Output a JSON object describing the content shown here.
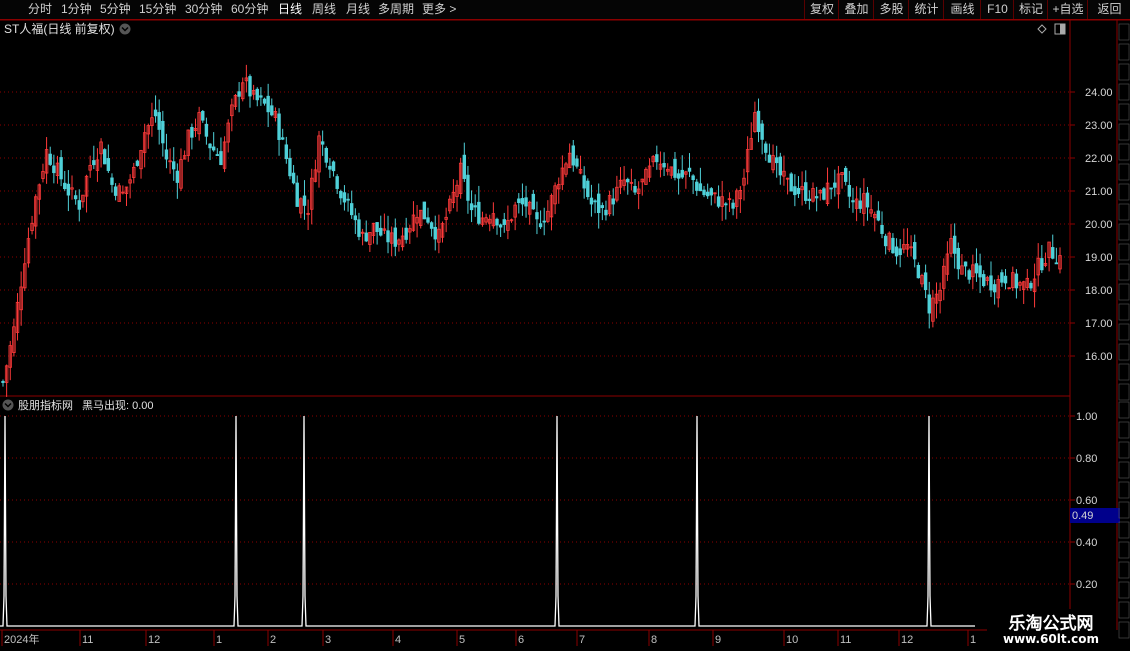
{
  "toolbar": {
    "periods": [
      "分时",
      "1分钟",
      "5分钟",
      "15分钟",
      "30分钟",
      "60分钟",
      "日线",
      "周线",
      "月线",
      "多周期",
      "更多 >"
    ],
    "active_period": "日线",
    "tools": [
      "复权",
      "叠加",
      "多股",
      "统计",
      "画线",
      "F10",
      "标记",
      "+自选",
      "返回"
    ]
  },
  "price_panel": {
    "title": "ST人福(日线 前复权)",
    "y_ticks": [
      "24.00",
      "23.00",
      "22.00",
      "21.00",
      "20.00",
      "19.00",
      "18.00",
      "17.00",
      "16.00"
    ]
  },
  "indicator_panel": {
    "title": "股朋指标网",
    "line_label": "黑马出现: 0.00",
    "y_ticks": [
      "1.00",
      "0.80",
      "0.60",
      "0.40",
      "0.20"
    ],
    "cursor_value": "0.49"
  },
  "x_axis": {
    "labels": [
      "2024年",
      "11",
      "12",
      "1",
      "2",
      "3",
      "4",
      "5",
      "6",
      "7",
      "8",
      "9",
      "10",
      "11",
      "12",
      "1"
    ]
  },
  "watermark": {
    "title": "乐淘公式网",
    "url": "www.60lt.com"
  },
  "colors": {
    "up": "#ff3a3a",
    "down": "#4fd0d8",
    "grid": "#8b0000",
    "signal": "#ffffff"
  },
  "chart_data": [
    {
      "type": "candlestick",
      "title": "ST人福(日线 前复权)",
      "ylim": [
        15.0,
        25.0
      ],
      "close_series_approx": [
        15.2,
        16.8,
        19.0,
        20.8,
        22.2,
        21.6,
        21.0,
        20.6,
        21.8,
        22.4,
        21.2,
        20.9,
        21.6,
        22.8,
        23.3,
        22.0,
        21.5,
        22.6,
        23.2,
        22.4,
        22.0,
        23.4,
        24.4,
        23.8,
        23.6,
        23.2,
        22.0,
        20.8,
        20.5,
        22.6,
        21.9,
        21.0,
        20.3,
        19.6,
        19.9,
        19.6,
        19.5,
        19.8,
        20.4,
        20.2,
        19.6,
        20.5,
        21.6,
        20.4,
        20.2,
        20.4,
        19.8,
        20.5,
        20.6,
        20.0,
        20.4,
        21.4,
        22.2,
        21.4,
        20.6,
        20.4,
        20.8,
        21.3,
        20.9,
        21.4,
        22.0,
        21.8,
        21.4,
        21.5,
        21.0,
        20.8,
        20.7,
        20.5,
        21.4,
        23.4,
        22.4,
        21.6,
        21.2,
        21.0,
        20.9,
        20.8,
        21.2,
        21.3,
        20.6,
        20.7,
        20.3,
        19.6,
        19.2,
        19.3,
        18.6,
        17.5,
        18.0,
        19.4,
        18.6,
        18.5,
        18.3,
        18.2,
        18.4,
        18.2,
        18.1,
        18.7,
        19.2,
        19.0
      ],
      "x_tick_labels": [
        "2024年",
        "11",
        "12",
        "1",
        "2",
        "3",
        "4",
        "5",
        "6",
        "7",
        "8",
        "9",
        "10",
        "11",
        "12",
        "1"
      ]
    },
    {
      "type": "line",
      "name": "黑马出现",
      "ylim": [
        0,
        1.1
      ],
      "baseline": 0,
      "spikes": [
        {
          "near_label": "2024年",
          "value": 1.0
        },
        {
          "near_label": "1",
          "value": 1.0
        },
        {
          "near_label": "2",
          "value": 1.0
        },
        {
          "near_label": "6",
          "value": 1.0
        },
        {
          "near_label": "8",
          "value": 1.0
        },
        {
          "near_label": "12",
          "value": 1.0
        }
      ]
    }
  ]
}
